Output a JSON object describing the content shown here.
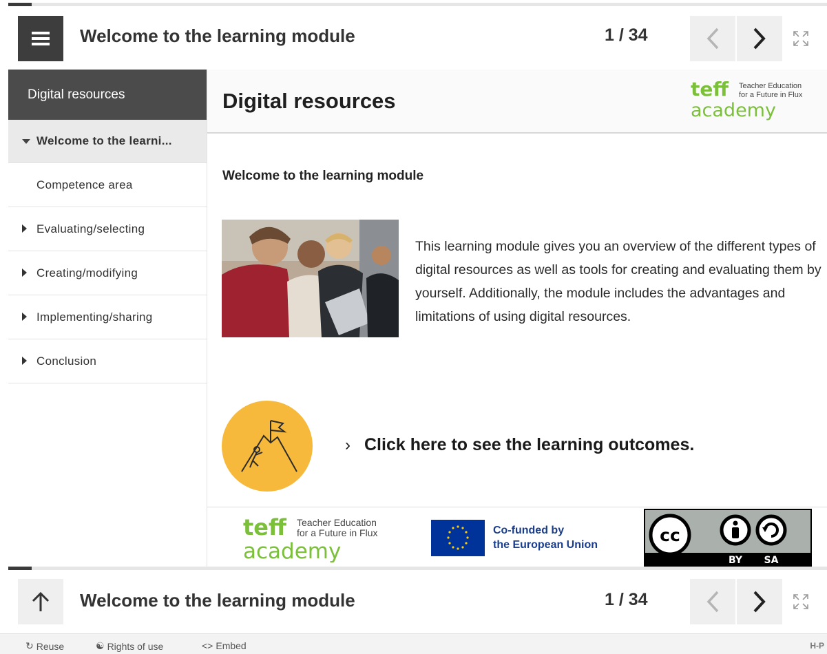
{
  "header": {
    "title": "Welcome to the learning module",
    "counter": "1 / 34",
    "progress_fraction": 0.029
  },
  "sidebar": {
    "heading": "Digital resources",
    "items": [
      {
        "label": "Welcome to the learni...",
        "state": "expanded"
      },
      {
        "label": "Competence area",
        "state": "child"
      },
      {
        "label": "Evaluating/selecting",
        "state": "collapsed"
      },
      {
        "label": "Creating/modifying",
        "state": "collapsed"
      },
      {
        "label": "Implementing/sharing",
        "state": "collapsed"
      },
      {
        "label": "Conclusion",
        "state": "collapsed"
      }
    ]
  },
  "main": {
    "title": "Digital resources",
    "intro_heading": "Welcome to the learning module",
    "intro_text": "This learning module gives you an overview of the different types of digital resources as well as tools for creating and evaluating them by yourself. Additionally, the module includes the advantages and limitations of using digital resources.",
    "outcome_chevron": "›",
    "outcome_link": "Click here to see the learning outcomes."
  },
  "logos": {
    "teff_word": "teff",
    "teff_line1": "Teacher Education",
    "teff_line2": "for a Future in Flux",
    "teff_academy": "academy",
    "eu_line1": "Co-funded by",
    "eu_line2": "the European Union",
    "cc_by": "BY",
    "cc_sa": "SA",
    "cc_mark": "cc"
  },
  "footer_bar": {
    "title": "Welcome to the learning module",
    "counter": "1 / 34"
  },
  "actions": {
    "reuse": "Reuse",
    "rights": "Rights of use",
    "embed": "Embed",
    "embed_icon": "<>",
    "brand": "H-P"
  },
  "colors": {
    "accent_dark": "#3d3d3d",
    "outcome_circle": "#f6b93b",
    "teff_green": "#7bbf3a",
    "eu_blue": "#003399",
    "eu_star": "#ffcc00"
  },
  "icons": [
    "menu-icon",
    "chevron-left-icon",
    "chevron-right-icon",
    "fullscreen-icon",
    "arrow-up-icon",
    "reuse-icon",
    "rights-icon",
    "embed-icon",
    "mountain-flag-icon"
  ]
}
